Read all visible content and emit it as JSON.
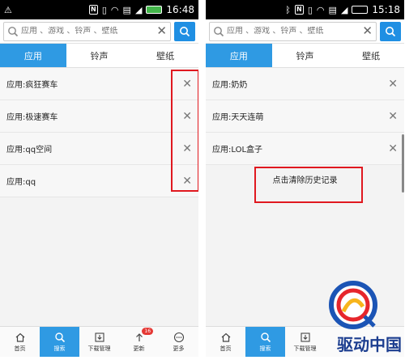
{
  "left": {
    "status": {
      "time": "16:48",
      "battery": ""
    },
    "search": {
      "placeholder": "应用 、游戏 、铃声 、壁纸"
    },
    "tabs": [
      {
        "label": "应用",
        "active": true
      },
      {
        "label": "铃声",
        "active": false
      },
      {
        "label": "壁纸",
        "active": false
      }
    ],
    "history": [
      {
        "label": "应用:疯狂赛车"
      },
      {
        "label": "应用:极速赛车"
      },
      {
        "label": "应用:qq空间"
      },
      {
        "label": "应用:qq"
      }
    ],
    "nav": [
      {
        "label": "首页",
        "icon": "home-icon",
        "active": false
      },
      {
        "label": "搜索",
        "icon": "search-icon",
        "active": true
      },
      {
        "label": "下载管理",
        "icon": "download-icon",
        "active": false
      },
      {
        "label": "更新",
        "icon": "update-icon",
        "active": false,
        "badge": "16"
      },
      {
        "label": "更多",
        "icon": "more-icon",
        "active": false
      }
    ]
  },
  "right": {
    "status": {
      "time": "15:18"
    },
    "search": {
      "placeholder": "应用 、游戏 、铃声 、壁纸"
    },
    "tabs": [
      {
        "label": "应用",
        "active": true
      },
      {
        "label": "铃声",
        "active": false
      },
      {
        "label": "壁纸",
        "active": false
      }
    ],
    "history": [
      {
        "label": "应用:奶奶"
      },
      {
        "label": "应用:天天连萌"
      },
      {
        "label": "应用:LOL盒子"
      }
    ],
    "clear_history_label": "点击清除历史记录",
    "nav": [
      {
        "label": "首页",
        "icon": "home-icon",
        "active": false
      },
      {
        "label": "搜索",
        "icon": "search-icon",
        "active": true
      },
      {
        "label": "下载管理",
        "icon": "download-icon",
        "active": false
      }
    ]
  },
  "watermark": {
    "text": "驱动中国"
  },
  "colors": {
    "accent": "#2f9ae3",
    "highlight": "#e0181f",
    "badge": "#e53935"
  }
}
